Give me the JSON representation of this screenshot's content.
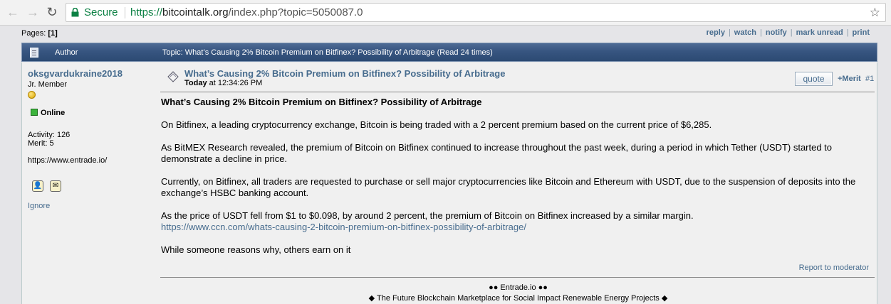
{
  "browser": {
    "back_glyph": "←",
    "forward_glyph": "→",
    "reload_glyph": "↻",
    "secure_label": "Secure",
    "url_protocol": "https://",
    "url_host": "bitcointalk.org",
    "url_path": "/index.php?topic=5050087.0",
    "star_glyph": "☆"
  },
  "pages": {
    "label": "Pages:",
    "current": "[1]"
  },
  "topnav": {
    "reply": "reply",
    "watch": "watch",
    "notify": "notify",
    "mark_unread": "mark unread",
    "print": "print",
    "sep": "|"
  },
  "catbar": {
    "author_label": "Author",
    "topic_label": "Topic: What’s Causing 2% Bitcoin Premium on Bitfinex? Possibility of Arbitrage  (Read 24 times)"
  },
  "poster": {
    "username": "oksgvardukraine2018",
    "rank": "Jr. Member",
    "online": "Online",
    "activity": "Activity: 126",
    "merit": "Merit: 5",
    "website": "https://www.entrade.io/",
    "ignore": "Ignore",
    "profile_icon_glyph": "👤",
    "pm_icon_glyph": "✉"
  },
  "post": {
    "subject": "What’s Causing 2% Bitcoin Premium on Bitfinex? Possibility of Arbitrage",
    "date_day": "Today",
    "date_time": " at 12:34:26 PM",
    "quote_label": "quote",
    "merit_label": "+Merit",
    "post_number": "#1",
    "heading": "What’s Causing 2% Bitcoin Premium on Bitfinex? Possibility of Arbitrage",
    "p1": "On Bitfinex, a leading cryptocurrency exchange, Bitcoin is being traded with a 2 percent premium based on the current price of $6,285.",
    "p2": "As BitMEX Research revealed, the premium of Bitcoin on Bitfinex continued to increase throughout the past week, during a period in which Tether (USDT) started to demonstrate a decline in price.",
    "p3": "Currently, on Bitfinex, all traders are requested to purchase or sell major cryptocurrencies like Bitcoin and Ethereum with USDT, due to the suspension of deposits into the exchange’s HSBC banking account.",
    "p4": "As the price of USDT fell from $1 to $0.098, by around 2 percent, the premium of Bitcoin on Bitfinex increased by a similar margin.",
    "link": "https://www.ccn.com/whats-causing-2-bitcoin-premium-on-bitfinex-possibility-of-arbitrage/",
    "p5": "While someone reasons why, others earn on it",
    "report": "Report to moderator",
    "sig_line1": "●● Entrade.io ●●",
    "sig_line2": "◆ The Future Blockchain Marketplace for Social Impact Renewable Energy Projects ◆"
  }
}
